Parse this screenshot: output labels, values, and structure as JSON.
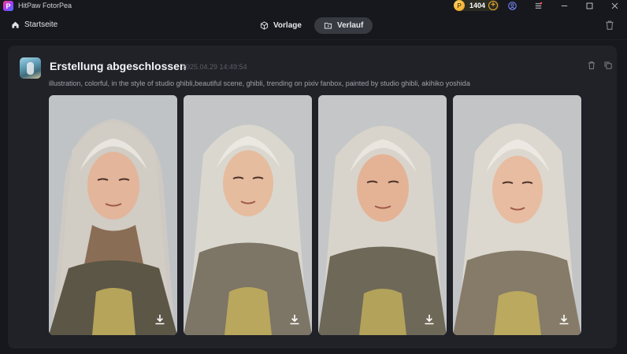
{
  "app": {
    "title": "HitPaw FotorPea",
    "logo_letter": "P",
    "coins": "1404",
    "coin_symbol": "P",
    "coin_add": "+"
  },
  "nav": {
    "home_label": "Startseite",
    "tabs": [
      {
        "label": "Vorlage",
        "active": false
      },
      {
        "label": "Verlauf",
        "active": true
      }
    ]
  },
  "history": {
    "title": "Erstellung abgeschlossen",
    "date": "2025.04.29 14:49:54",
    "prompt": "illustration, colorful, in the style of studio ghibli,beautiful scene, ghibli, trending on pixiv fanbox, painted by studio ghibli, akihiko yoshida",
    "images": [
      {
        "icon": "download-icon"
      },
      {
        "icon": "download-icon"
      },
      {
        "icon": "download-icon"
      },
      {
        "icon": "download-icon"
      }
    ]
  },
  "colors": {
    "background": "#16181d",
    "card": "#202228",
    "active_tab": "#383a41",
    "coin": "#f0a92a"
  }
}
